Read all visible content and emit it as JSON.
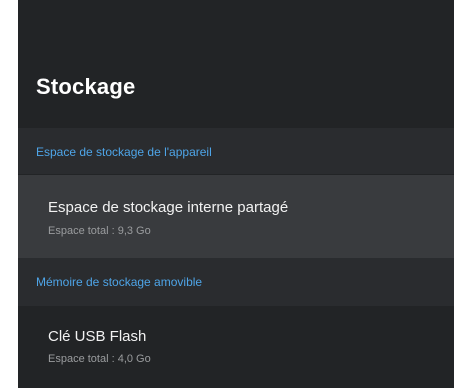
{
  "page": {
    "title": "Stockage"
  },
  "sections": [
    {
      "header": "Espace de stockage de l'appareil",
      "item": {
        "title": "Espace de stockage interne partagé",
        "subtitle": "Espace total : 9,3 Go"
      }
    },
    {
      "header": "Mémoire de stockage amovible",
      "item": {
        "title": "Clé USB Flash",
        "subtitle": "Espace total : 4,0 Go"
      }
    }
  ],
  "colors": {
    "background": "#222426",
    "section_header_background": "#2a2c2f",
    "selected_item_background": "#393b3e",
    "accent": "#4ea5e8"
  }
}
